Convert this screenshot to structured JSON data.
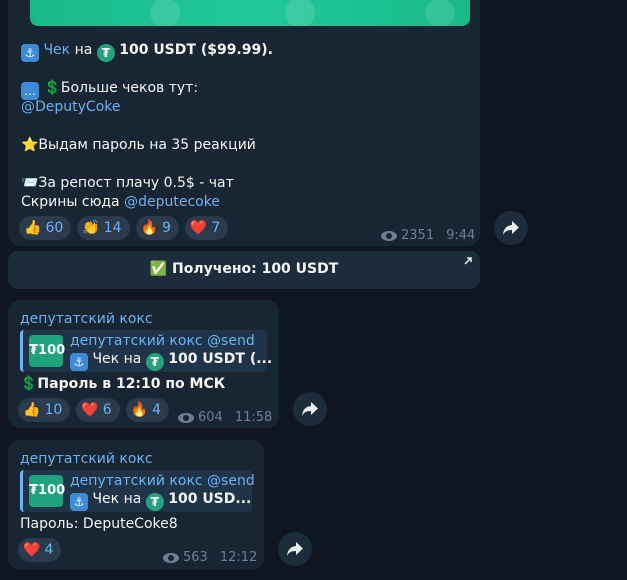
{
  "message1": {
    "check_prefix": "Чек",
    "check_middle": "на",
    "check_amount": "100 USDT ($99.99).",
    "more_checks": "💲Больше чеков тут:",
    "mention1": "@DeputyCoke",
    "password_note": "⭐Выдам пароль на 35 реакций",
    "repost_note": "📨За репост плачу 0.5$ - чат",
    "screens_prefix": "Скрины сюда",
    "mention2": "@deputecoke",
    "reactions": [
      {
        "glyph": "👍",
        "count": "60"
      },
      {
        "glyph": "👏",
        "count": "14"
      },
      {
        "glyph": "🔥",
        "count": "9"
      },
      {
        "glyph": "❤️",
        "count": "7"
      }
    ],
    "views": "2351",
    "time": "9:44",
    "button_label": "✅ Получено: 100 USDT"
  },
  "message2": {
    "sender": "депутатский кокс",
    "quote_title": "депутатский кокс @send",
    "quote_text": "Чек на",
    "quote_amount": "100 USDT (...",
    "thumb_label": "₮100",
    "body": "💲Пароль в 12:10 по МСК",
    "reactions": [
      {
        "glyph": "👍",
        "count": "10"
      },
      {
        "glyph": "❤️",
        "count": "6"
      },
      {
        "glyph": "🔥",
        "count": "4"
      }
    ],
    "views": "604",
    "time": "11:58"
  },
  "message3": {
    "sender": "депутатский кокс",
    "quote_title": "депутатский кокс @send",
    "quote_text": "Чек на",
    "quote_amount": "100 USD...",
    "thumb_label": "₮100",
    "body": "Пароль: DeputeCoke8",
    "reactions": [
      {
        "glyph": "❤️",
        "count": "4"
      }
    ],
    "views": "563",
    "time": "12:12"
  },
  "colors": {
    "background": "#0e1621",
    "bubble": "#182533",
    "link": "#6ab3f3",
    "tether": "#26a17b"
  }
}
